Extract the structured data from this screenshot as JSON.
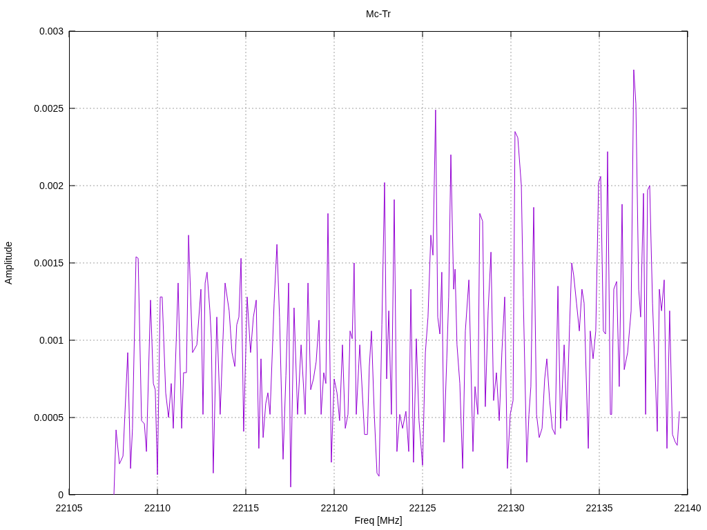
{
  "chart_data": {
    "type": "line",
    "grid": true,
    "title": "Mc-Tr",
    "xlabel": "Freq [MHz]",
    "ylabel": "Amplitude",
    "xlim": [
      22105,
      22140
    ],
    "ylim": [
      0,
      0.003
    ],
    "xticks": [
      22105,
      22110,
      22115,
      22120,
      22125,
      22130,
      22135,
      22140
    ],
    "yticks": [
      {
        "value": 0,
        "label": "0"
      },
      {
        "value": 0.0005,
        "label": "0.0005"
      },
      {
        "value": 0.001,
        "label": "0.001"
      },
      {
        "value": 0.0015,
        "label": "0.0015"
      },
      {
        "value": 0.002,
        "label": "0.002"
      },
      {
        "value": 0.0025,
        "label": "0.0025"
      },
      {
        "value": 0.003,
        "label": "0.003"
      }
    ],
    "x": [
      22107.54,
      22107.66,
      22107.85,
      22108.05,
      22108.16,
      22108.32,
      22108.48,
      22108.59,
      22108.79,
      22108.91,
      22109.1,
      22109.26,
      22109.38,
      22109.61,
      22109.77,
      22109.88,
      22110.0,
      22110.16,
      22110.27,
      22110.47,
      22110.63,
      22110.78,
      22110.9,
      22111.17,
      22111.37,
      22111.48,
      22111.64,
      22111.76,
      22111.99,
      22112.23,
      22112.46,
      22112.58,
      22112.7,
      22112.81,
      22112.97,
      22113.05,
      22113.16,
      22113.36,
      22113.55,
      22113.83,
      22114.06,
      22114.22,
      22114.38,
      22114.49,
      22114.61,
      22114.73,
      22114.88,
      22115.08,
      22115.27,
      22115.43,
      22115.59,
      22115.74,
      22115.86,
      22115.98,
      22116.13,
      22116.25,
      22116.37,
      22116.6,
      22116.76,
      22116.91,
      22117.11,
      22117.27,
      22117.42,
      22117.54,
      22117.73,
      22117.93,
      22118.13,
      22118.36,
      22118.52,
      22118.67,
      22118.83,
      22118.98,
      22119.14,
      22119.26,
      22119.41,
      22119.53,
      22119.65,
      22119.84,
      22120.0,
      22120.16,
      22120.31,
      22120.47,
      22120.63,
      22120.78,
      22120.9,
      22121.02,
      22121.13,
      22121.25,
      22121.45,
      22121.72,
      22121.88,
      22121.99,
      22122.11,
      22122.27,
      22122.42,
      22122.54,
      22122.7,
      22122.85,
      22122.97,
      22123.09,
      22123.24,
      22123.4,
      22123.55,
      22123.71,
      22123.87,
      22124.06,
      22124.22,
      22124.34,
      22124.49,
      22124.65,
      22124.8,
      22125.0,
      22125.16,
      22125.31,
      22125.47,
      22125.59,
      22125.74,
      22125.86,
      22125.98,
      22126.09,
      22126.21,
      22126.37,
      22126.48,
      22126.6,
      22126.76,
      22126.84,
      22126.95,
      22127.11,
      22127.27,
      22127.42,
      22127.62,
      22127.73,
      22127.85,
      22127.97,
      22128.13,
      22128.24,
      22128.4,
      22128.55,
      22128.71,
      22128.87,
      22129.02,
      22129.18,
      22129.34,
      22129.49,
      22129.65,
      22129.8,
      22129.96,
      22130.12,
      22130.23,
      22130.39,
      22130.59,
      22130.7,
      22130.9,
      22131.02,
      22131.13,
      22131.29,
      22131.45,
      22131.6,
      22131.76,
      22131.91,
      22132.03,
      22132.19,
      22132.34,
      22132.5,
      22132.66,
      22132.81,
      22133.01,
      22133.16,
      22133.32,
      22133.44,
      22133.55,
      22133.71,
      22133.87,
      22134.02,
      22134.14,
      22134.38,
      22134.49,
      22134.65,
      22134.8,
      22134.96,
      22135.08,
      22135.23,
      22135.35,
      22135.47,
      22135.63,
      22135.7,
      22135.82,
      22135.98,
      22136.13,
      22136.29,
      22136.41,
      22136.6,
      22136.8,
      22136.95,
      22137.07,
      22137.23,
      22137.34,
      22137.5,
      22137.62,
      22137.73,
      22137.85,
      22138.01,
      22138.16,
      22138.28,
      22138.4,
      22138.52,
      22138.67,
      22138.83,
      22138.98,
      22139.14,
      22139.3,
      22139.41,
      22139.53
    ],
    "series": [
      {
        "color": "#9400d3",
        "values": [
          0,
          0.00042,
          0.0002,
          0.00025,
          0.00052,
          0.00092,
          0.00017,
          0.00043,
          0.00154,
          0.00153,
          0.00048,
          0.00046,
          0.00028,
          0.00126,
          0.00072,
          0.00068,
          0.00013,
          0.00128,
          0.00128,
          0.00066,
          0.0005,
          0.00072,
          0.00043,
          0.00137,
          0.00043,
          0.00079,
          0.00079,
          0.00168,
          0.00092,
          0.00097,
          0.00133,
          0.00052,
          0.00137,
          0.00144,
          0.00119,
          0.00101,
          0.00014,
          0.00115,
          0.00052,
          0.00137,
          0.00119,
          0.00092,
          0.00083,
          0.0011,
          0.00115,
          0.00153,
          0.00041,
          0.00128,
          0.00092,
          0.00115,
          0.00126,
          0.0003,
          0.00088,
          0.00037,
          0.00059,
          0.00066,
          0.00052,
          0.00124,
          0.00162,
          0.00115,
          0.00023,
          0.00077,
          0.00137,
          5e-05,
          0.00121,
          0.00052,
          0.00097,
          0.00052,
          0.00137,
          0.00068,
          0.00075,
          0.00086,
          0.00113,
          0.00052,
          0.00079,
          0.00072,
          0.00182,
          0.00021,
          0.00075,
          0.00066,
          0.00048,
          0.00097,
          0.00043,
          0.00052,
          0.00106,
          0.00101,
          0.0015,
          0.00052,
          0.00097,
          0.00039,
          0.00039,
          0.00083,
          0.00106,
          0.00052,
          0.00014,
          0.00012,
          0.0011,
          0.00202,
          0.00075,
          0.00119,
          0.00052,
          0.00191,
          0.00028,
          0.00052,
          0.00043,
          0.00054,
          0.00028,
          0.00133,
          0.00021,
          0.00101,
          0.00048,
          0.00019,
          0.00092,
          0.00115,
          0.00168,
          0.00155,
          0.00249,
          0.00115,
          0.00104,
          0.00144,
          0.00034,
          0.00088,
          0.00128,
          0.0022,
          0.00133,
          0.00146,
          0.00097,
          0.00072,
          0.00017,
          0.00106,
          0.00139,
          0.00088,
          0.00028,
          0.0007,
          0.00052,
          0.00182,
          0.00177,
          0.00057,
          0.00119,
          0.00157,
          0.00061,
          0.00079,
          0.00048,
          0.00092,
          0.00128,
          0.00017,
          0.00052,
          0.00061,
          0.00235,
          0.00231,
          0.002,
          0.00128,
          0.00021,
          0.00052,
          0.0007,
          0.00186,
          0.00052,
          0.00037,
          0.00043,
          0.00075,
          0.00088,
          0.00061,
          0.00043,
          0.00039,
          0.00135,
          0.00043,
          0.00097,
          0.00048,
          0.0011,
          0.0015,
          0.00142,
          0.00124,
          0.00106,
          0.00133,
          0.00124,
          0.0003,
          0.00106,
          0.00088,
          0.00106,
          0.00202,
          0.00206,
          0.00106,
          0.00104,
          0.00222,
          0.00052,
          0.00052,
          0.00133,
          0.00138,
          0.0007,
          0.00188,
          0.00081,
          0.00092,
          0.00119,
          0.00275,
          0.00253,
          0.00133,
          0.00115,
          0.00195,
          0.00052,
          0.00197,
          0.002,
          0.00124,
          0.00079,
          0.00041,
          0.00133,
          0.00119,
          0.00139,
          0.0003,
          0.00119,
          0.00039,
          0.00034,
          0.00032,
          0.00054
        ]
      }
    ]
  }
}
